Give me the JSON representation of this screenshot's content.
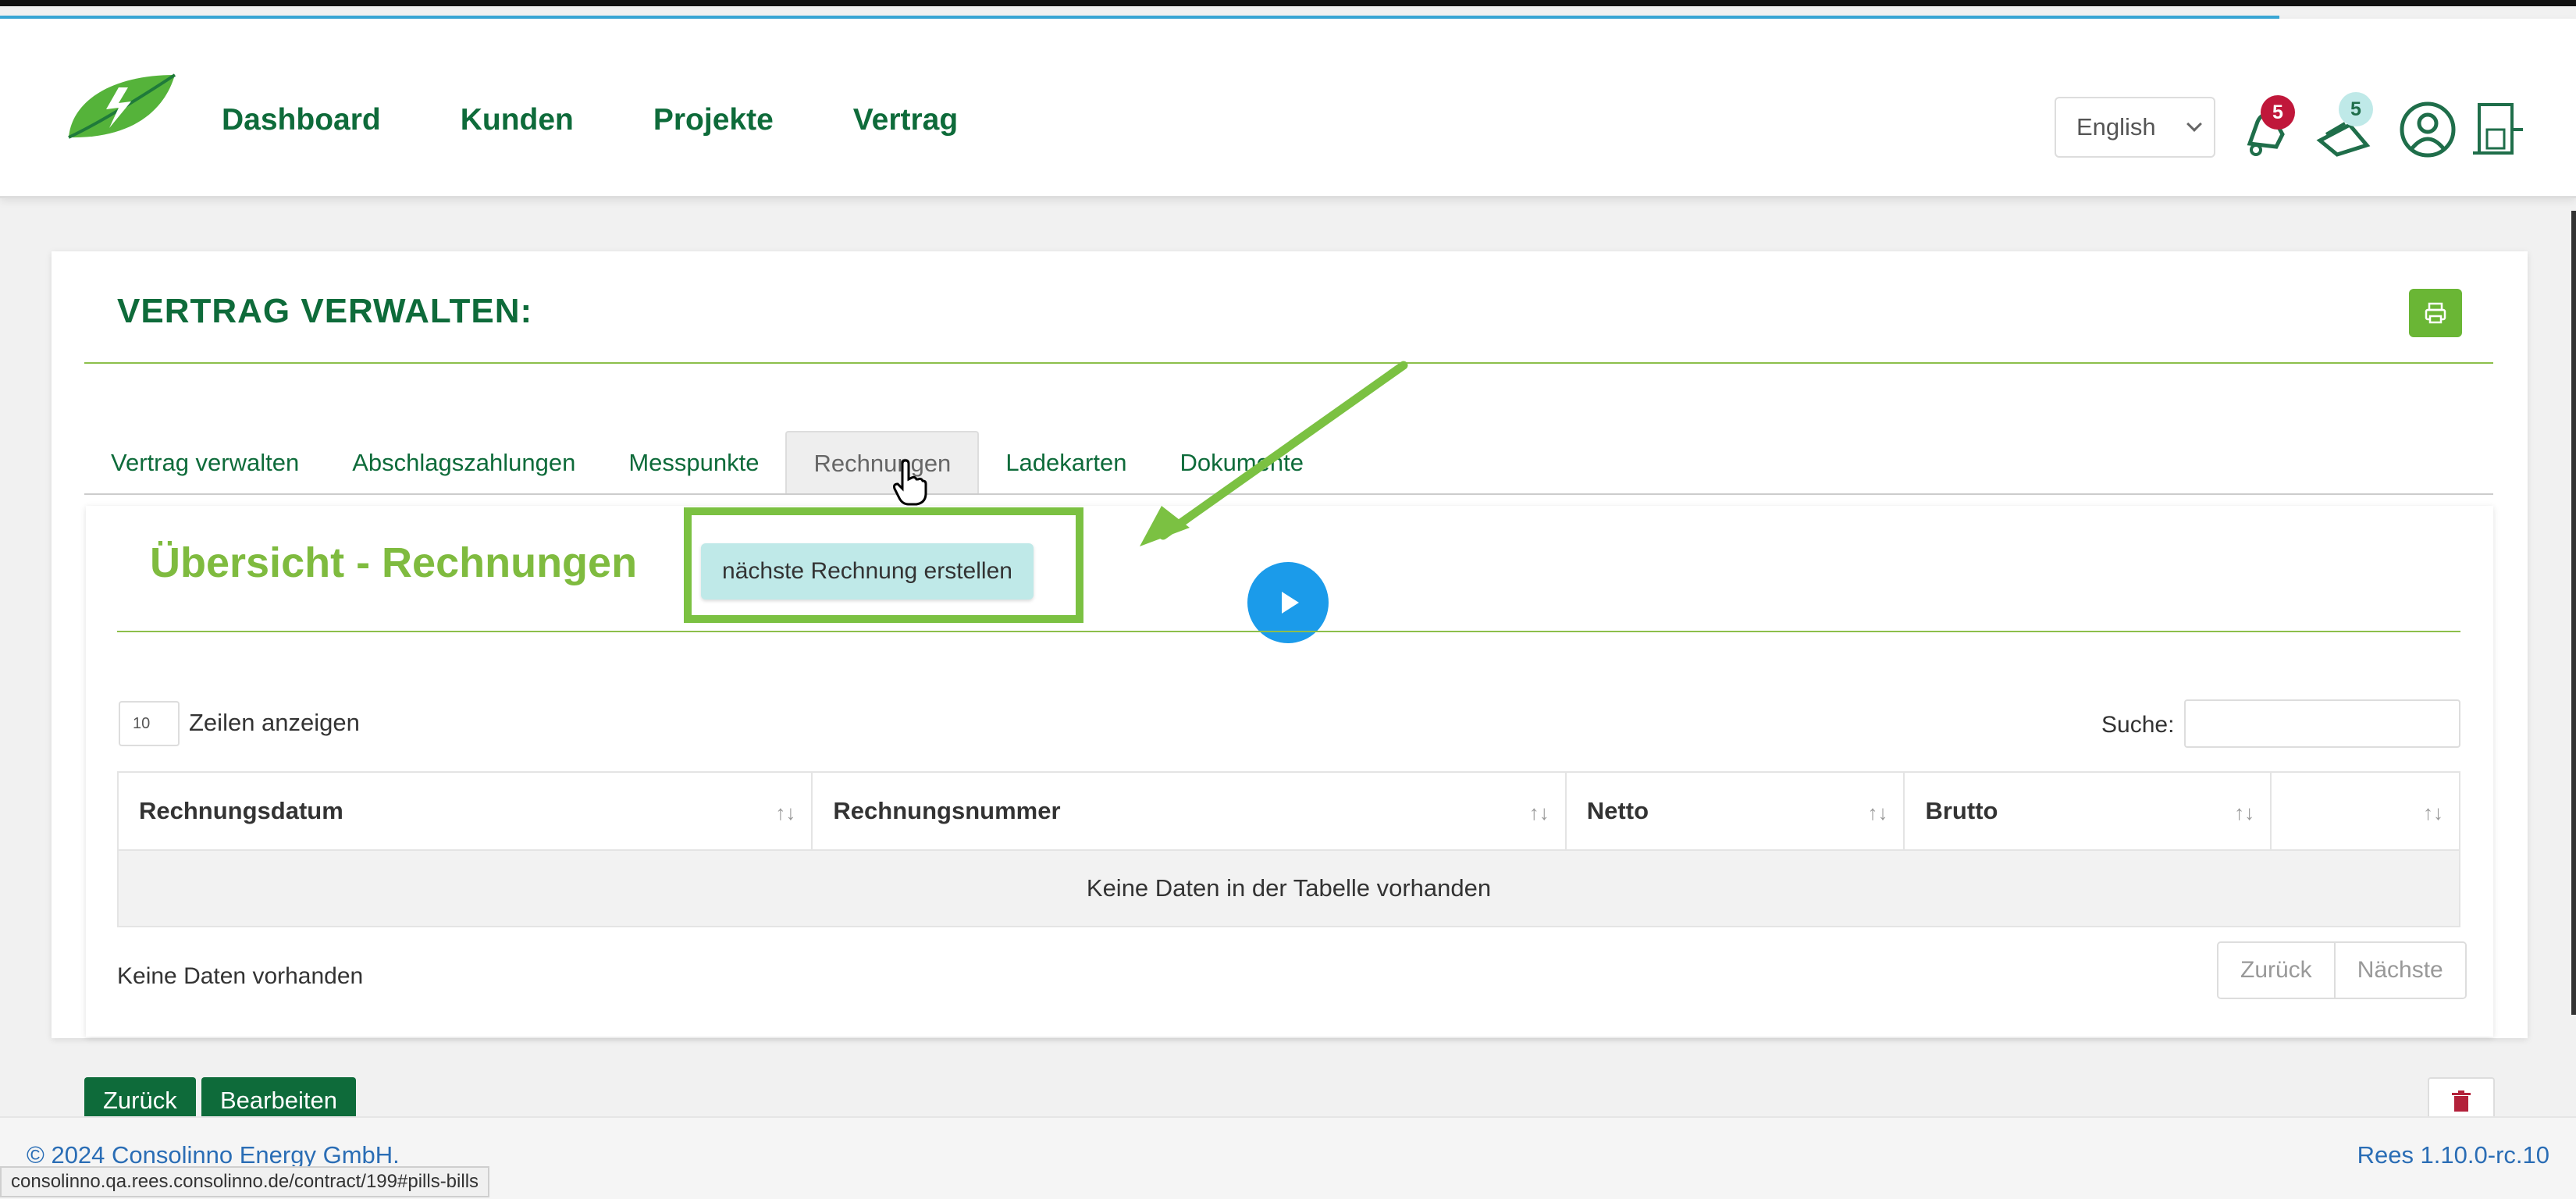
{
  "nav": {
    "items": [
      {
        "label": "Dashboard"
      },
      {
        "label": "Kunden"
      },
      {
        "label": "Projekte"
      },
      {
        "label": "Vertrag"
      }
    ],
    "language": "English",
    "notifications_count": "5",
    "messages_count": "5",
    "brand_color": "#0e6b3a",
    "accent_color": "#7fbb3f"
  },
  "page": {
    "title": "VERTRAG VERWALTEN:"
  },
  "tabs": [
    {
      "label": "Vertrag verwalten"
    },
    {
      "label": "Abschlagszahlungen"
    },
    {
      "label": "Messpunkte"
    },
    {
      "label": "Rechnungen",
      "active": true
    },
    {
      "label": "Ladekarten"
    },
    {
      "label": "Dokumente"
    }
  ],
  "section": {
    "title": "Übersicht - Rechnungen",
    "create_button": "nächste Rechnung erstellen"
  },
  "table": {
    "length_value": "10",
    "length_label": "Zeilen anzeigen",
    "search_label": "Suche:",
    "columns": [
      "Rechnungsdatum",
      "Rechnungsnummer",
      "Netto",
      "Brutto",
      ""
    ],
    "empty_message": "Keine Daten in der Tabelle vorhanden",
    "info": "Keine Daten vorhanden",
    "prev": "Zurück",
    "next": "Nächste"
  },
  "actions": {
    "back": "Zurück",
    "edit": "Bearbeiten"
  },
  "footer": {
    "copyright": "© 2024 Consolinno Energy GmbH.",
    "version": "Rees 1.10.0-rc.10",
    "status_url": "consolinno.qa.rees.consolinno.de/contract/199#pills-bills"
  }
}
